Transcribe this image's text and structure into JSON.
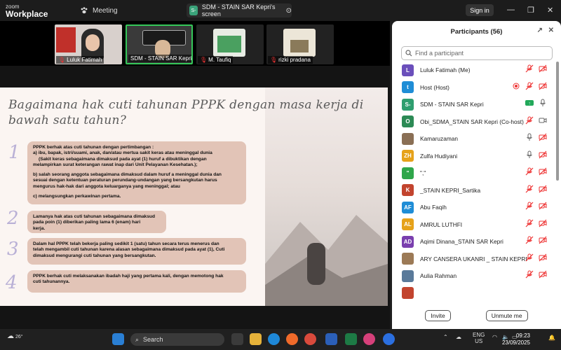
{
  "app": {
    "brand_top": "zoom",
    "brand_bottom": "Workplace",
    "meeting_label": "Meeting",
    "share_badge": "S-",
    "share_title": "SDM - STAIN SAR Kepri's screen",
    "signin_label": "Sign in"
  },
  "thumbs": [
    {
      "label": "Luluk Fatimah"
    },
    {
      "label": "SDM - STAIN SAR Kepri"
    },
    {
      "label": "M. Taufiq"
    },
    {
      "label": "rizki pradana"
    }
  ],
  "slide": {
    "title": "Bagaimana hak cuti tahunan PPPK dengan masa kerja di bawah satu tahun?",
    "items": [
      {
        "num": "1",
        "text": [
          "PPPK berhak atas cuti tahunan dengan pertimbangan :",
          "a) ibu, bapak, istri/suami, anak, dan/atau mertua sakit keras atau meninggal dunia",
          "(Sakit keras sebagaimana dimaksud pada ayat (1) huruf a dibuktikan dengan",
          "melampirkan surat keterangan rawat inap dari Unit Pelayanan Kesehatan.);",
          "",
          "b) salah seorang anggota sebagaimana dimaksud dalam huruf a meninggal dunia dan",
          "sesuai dengan ketentuan peraturan perundang-undangan yang bersangkutan harus",
          "mengurus hak-hak dari anggota keluarganya yang meninggal; atau",
          "",
          "c) melangsungkan perkawinan pertama."
        ]
      },
      {
        "num": "2",
        "text": [
          "Lamanya hak atas cuti tahunan sebagaimana dimaksud",
          "pada poin (1) diberikan paling lama 6 (enam) hari",
          "kerja."
        ]
      },
      {
        "num": "3",
        "text": [
          "Dalam hal PPPK telah bekerja paling sedikit 1 (satu) tahun secara terus menerus dan",
          "telah mengambil cuti tahunan karena alasan sebagaimana dimaksud pada ayat (1), Cuti",
          "dimaksud mengurangi cuti tahunan yang bersangkutan."
        ]
      },
      {
        "num": "4",
        "text": [
          "PPPK berhak cuti melaksanakan ibadah haji yang pertama kali, dengan memotong hak",
          "cuti tahunannya."
        ]
      }
    ]
  },
  "participants": {
    "title": "Participants (56)",
    "search_placeholder": "Find a participant",
    "list": [
      {
        "initial": "L",
        "name": "Luluk Fatimah (Me)",
        "color": "#6b4fbb",
        "icons": [
          "mic-muted-icon",
          "video-off-icon"
        ]
      },
      {
        "initial": "t",
        "name": "Host (Host)",
        "color": "#1f8dd6",
        "icons": [
          "record-icon",
          "mic-muted-icon",
          "video-off-icon"
        ]
      },
      {
        "initial": "S-",
        "name": "SDM - STAIN SAR Kepri",
        "color": "#2f9e6f",
        "icons": [
          "share-badge-icon",
          "mic-icon"
        ]
      },
      {
        "initial": "O",
        "name": "Obi_SDMA_STAIN SAR Kepri (Co-host)",
        "color": "#2c8a55",
        "icons": [
          "mic-muted-icon",
          "video-icon"
        ]
      },
      {
        "initial": "",
        "name": "Kamaruzaman",
        "color": "#8a6f55",
        "icons": [
          "mic-icon",
          "video-off-icon"
        ]
      },
      {
        "initial": "ZH",
        "name": "Zulfa Hudiyani",
        "color": "#e6a21a",
        "icons": [
          "mic-icon",
          "video-off-icon"
        ]
      },
      {
        "initial": "\"",
        "name": "\",\"",
        "color": "#2fa64a",
        "icons": [
          "mic-muted-icon",
          "video-off-icon"
        ]
      },
      {
        "initial": "K",
        "name": "_STAIN KEPRI_Sartika",
        "color": "#c2442e",
        "icons": [
          "mic-muted-icon",
          "video-off-icon"
        ]
      },
      {
        "initial": "AF",
        "name": "Abu Faqih",
        "color": "#1f8dd6",
        "icons": [
          "mic-muted-icon",
          "video-off-icon"
        ]
      },
      {
        "initial": "AL",
        "name": "AMRUL LUTHFI",
        "color": "#e6a21a",
        "icons": [
          "mic-muted-icon",
          "video-off-icon"
        ]
      },
      {
        "initial": "AD",
        "name": "Aqimi Dinana_STAIN SAR Kepri",
        "color": "#7a3fae",
        "icons": [
          "mic-muted-icon",
          "video-off-icon"
        ]
      },
      {
        "initial": "",
        "name": "ARY CANSERA UKANRI _ STAIN KEPRI",
        "color": "#9c7a56",
        "icons": [
          "mic-muted-icon",
          "video-off-icon"
        ]
      },
      {
        "initial": "",
        "name": "Aulia Rahman",
        "color": "#5a7a9a",
        "icons": [
          "mic-muted-icon",
          "video-off-icon"
        ]
      },
      {
        "initial": "",
        "name": "",
        "color": "#c2442e",
        "icons": []
      }
    ],
    "invite_label": "Invite",
    "unmute_label": "Unmute me"
  },
  "taskbar": {
    "temp": "26°",
    "search_label": "Search",
    "lang_top": "ENG",
    "lang_bottom": "US",
    "time": "09:23",
    "date": "23/09/2025"
  }
}
